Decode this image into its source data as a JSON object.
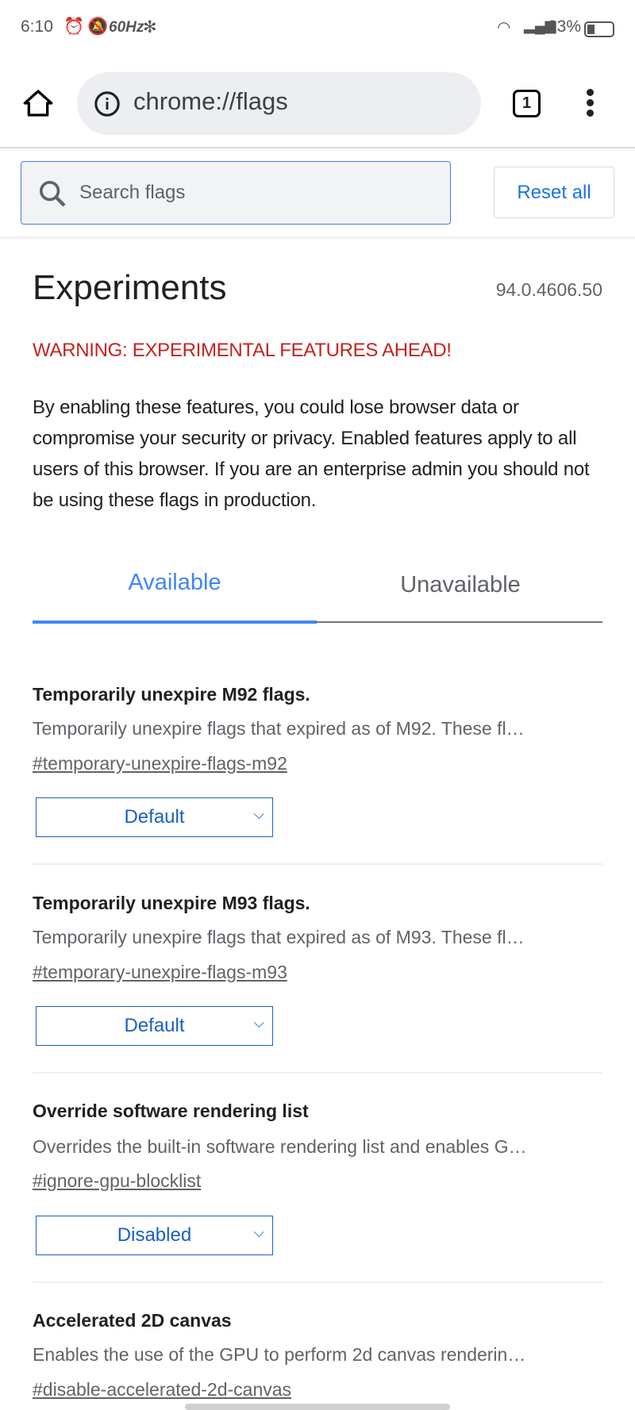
{
  "status_bar": {
    "time": "6:10",
    "refresh": "60Hz",
    "battery": "23%"
  },
  "toolbar": {
    "url": "chrome://flags",
    "tab_count": "1"
  },
  "search": {
    "placeholder": "Search flags",
    "reset_label": "Reset all"
  },
  "header": {
    "title": "Experiments",
    "version": "94.0.4606.50",
    "warning": "WARNING: EXPERIMENTAL FEATURES AHEAD!",
    "description": "By enabling these features, you could lose browser data or compromise your security or privacy. Enabled features apply to all users of this browser. If you are an enterprise admin you should not be using these flags in production."
  },
  "tabs": [
    {
      "label": "Available",
      "active": true
    },
    {
      "label": "Unavailable",
      "active": false
    }
  ],
  "colors": {
    "accent": "#1a73e8",
    "warning": "#c5221f"
  },
  "flags": [
    {
      "title": "Temporarily unexpire M92 flags.",
      "description": "Temporarily unexpire flags that expired as of M92. These fl…",
      "link": "#temporary-unexpire-flags-m92",
      "value": "Default"
    },
    {
      "title": "Temporarily unexpire M93 flags.",
      "description": "Temporarily unexpire flags that expired as of M93. These fl…",
      "link": "#temporary-unexpire-flags-m93",
      "value": "Default"
    },
    {
      "title": "Override software rendering list",
      "description": "Overrides the built-in software rendering list and enables G…",
      "link": "#ignore-gpu-blocklist",
      "value": "Disabled"
    },
    {
      "title": "Accelerated 2D canvas",
      "description": "Enables the use of the GPU to perform 2d canvas renderin…",
      "link": "#disable-accelerated-2d-canvas"
    }
  ]
}
